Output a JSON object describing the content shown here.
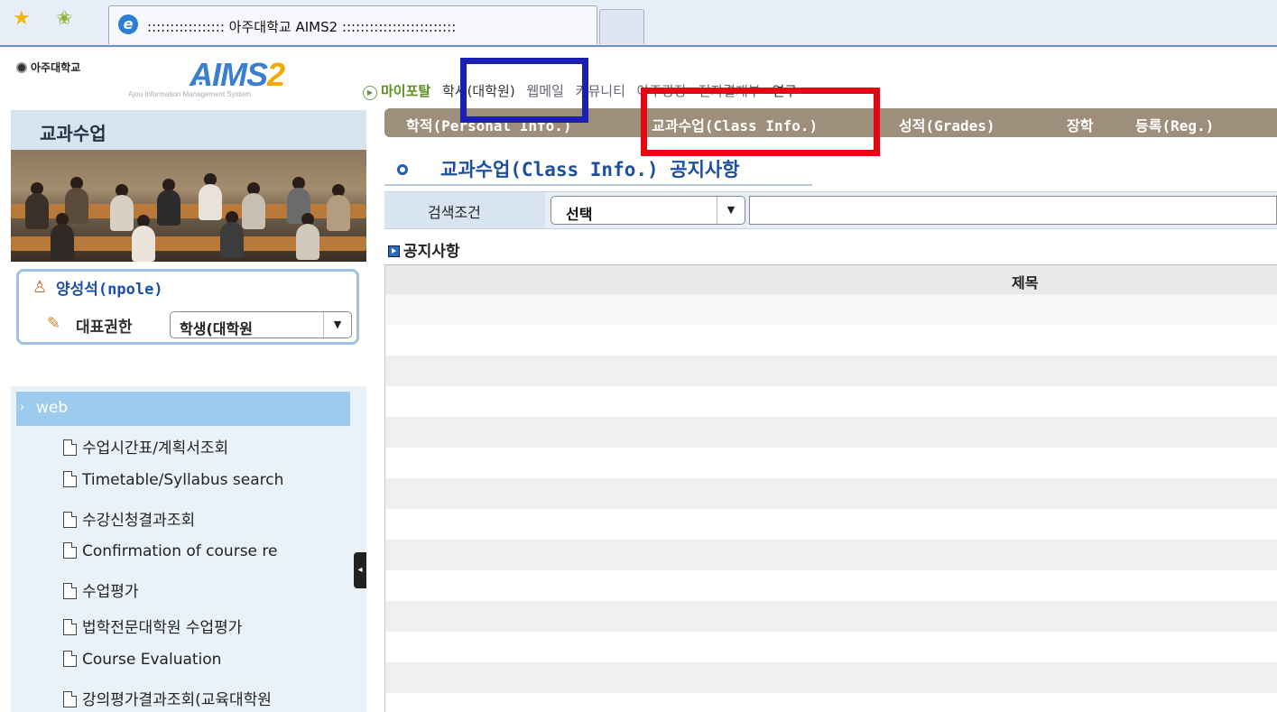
{
  "browser": {
    "tab_title": "::::::::::::::::: 아주대학교 AIMS2 :::::::::::::::::::::::::",
    "ie_icon": "e"
  },
  "header": {
    "university": "아주대학교",
    "logo_main": "AIMS",
    "logo_num": "2",
    "logo_sub": "Ajou Information Management System"
  },
  "top_nav": {
    "items": [
      {
        "label": "마이포탈"
      },
      {
        "label": "학사(대학원)"
      },
      {
        "label": "웹메일"
      },
      {
        "label": "커뮤니티"
      },
      {
        "label": "아주광장"
      },
      {
        "label": "전자결재부"
      },
      {
        "label": "연구"
      }
    ]
  },
  "sub_nav": {
    "items": [
      {
        "label": "학적(Personal Info.)"
      },
      {
        "label": "교과수업(Class Info.)"
      },
      {
        "label": "성적(Grades)"
      },
      {
        "label": "장학"
      },
      {
        "label": "등록(Reg.)"
      }
    ]
  },
  "sidebar": {
    "title": "교과수업",
    "user_name": "양성석(npole)",
    "role_label": "대표권한",
    "role_value": "학생(대학원",
    "menu_head": "web",
    "menu_items": [
      {
        "label": "수업시간표/계획서조회"
      },
      {
        "label": "Timetable/Syllabus search"
      },
      {
        "label": "수강신청결과조회"
      },
      {
        "label": "Confirmation of course re"
      },
      {
        "label": "수업평가"
      },
      {
        "label": "법학전문대학원 수업평가"
      },
      {
        "label": "Course Evaluation"
      },
      {
        "label": "강의평가결과조회(교육대학원"
      }
    ]
  },
  "main": {
    "page_title": "교과수업(Class Info.) 공지사항",
    "search_label": "검색조건",
    "search_select": "선택",
    "search_value": "",
    "notice_heading": "공지사항",
    "grid_column": "제목"
  },
  "colors": {
    "highlight_blue": "#1b1fb3",
    "highlight_red": "#e30613",
    "subnav_bg": "#9e8f7c",
    "sidebar_accent": "#9dcbed"
  }
}
